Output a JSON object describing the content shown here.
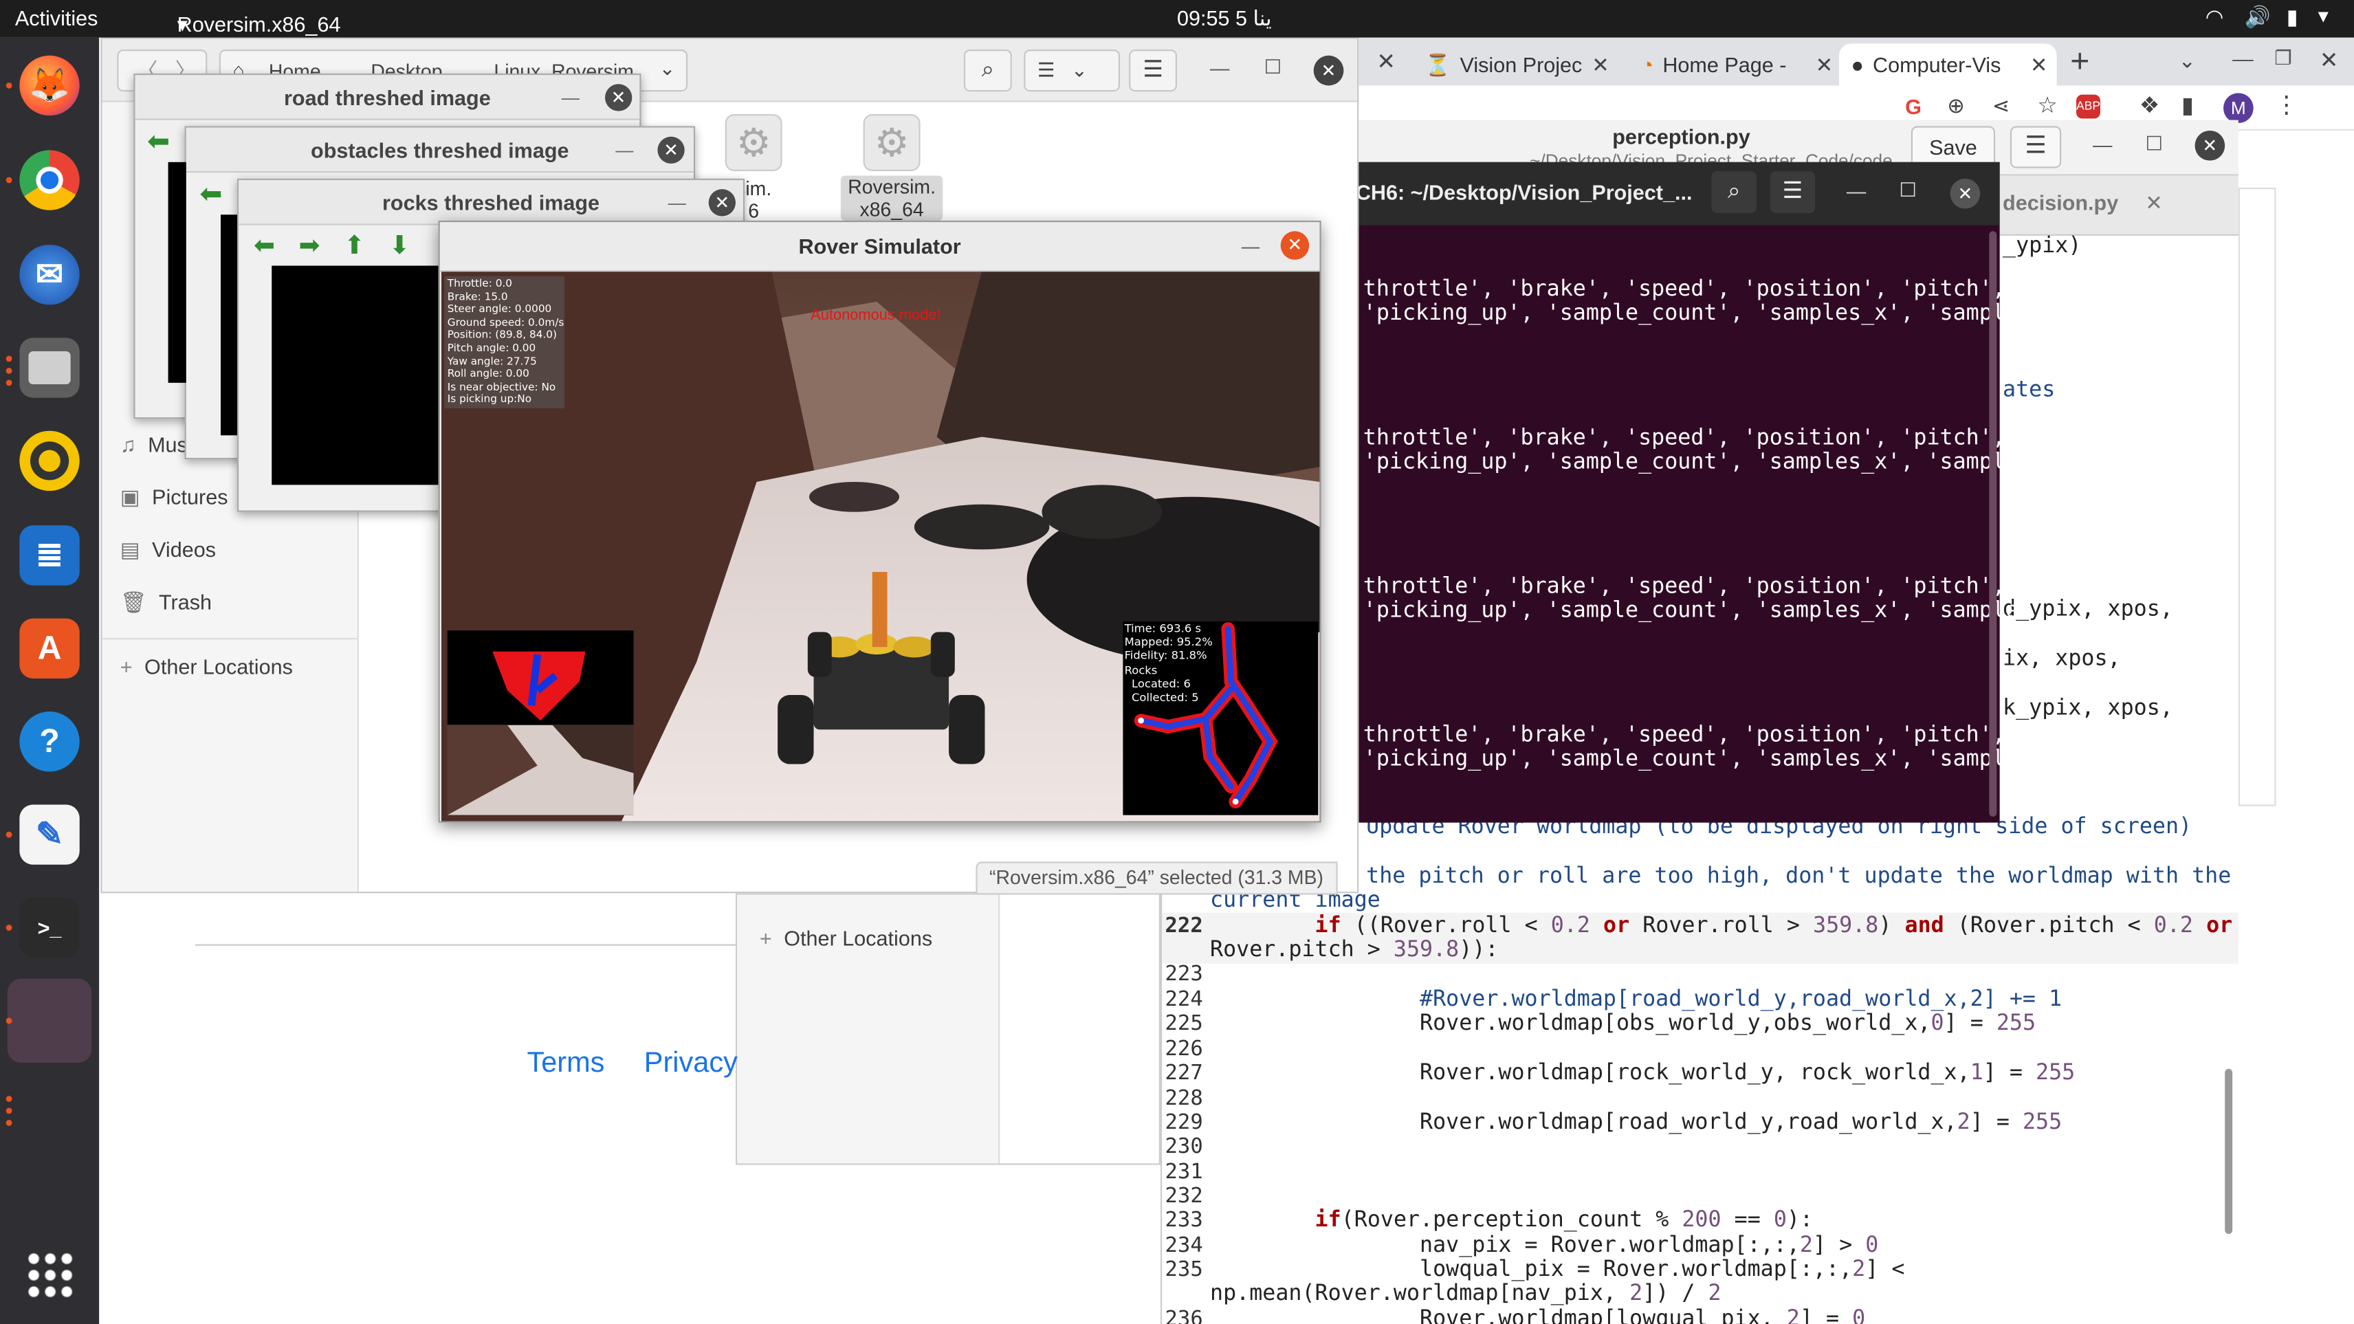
{
  "topbar": {
    "activities": "Activities",
    "app_menu": "Roversim.x86_64",
    "clock": "09:55 ﻳﻨﺎ 5"
  },
  "browser": {
    "tabs": [
      {
        "label": "Vision Projec",
        "icon": "vision-tab-icon"
      },
      {
        "label": "Home Page -",
        "icon": "home-tab-icon"
      },
      {
        "label": "Computer-Vis",
        "icon": "github-icon"
      }
    ],
    "footer_links": [
      "Terms",
      "Privacy"
    ],
    "avatar_letter": "M"
  },
  "gedit": {
    "title": "perception.py",
    "subtitle": "~/Desktop/Vision_Project_Starter_Code/code",
    "save_label": "Save",
    "tab_label": "decision.py",
    "right_fragments": [
      "_ypix)",
      "ates",
      "d_ypix, xpos,",
      "ix, xpos,",
      "k_ypix, xpos,"
    ],
    "comment_1": "Update Rover worldmap (to be displayed on right side of screen)",
    "comment_2": "the pitch or roll are too high, don't update the worldmap with the",
    "comment_3": "current image",
    "line_numbers": [
      "222",
      "223",
      "224",
      "225",
      "226",
      "227",
      "228",
      "229",
      "230",
      "231",
      "232",
      "233",
      "234",
      "235",
      "",
      "236"
    ]
  },
  "terminal": {
    "title": "CH6: ~/Desktop/Vision_Project_...",
    "line_a": "throttle', 'brake', 'speed', 'position', 'pitch',",
    "line_b": "'picking_up', 'sample_count', 'samples_x', 'sample"
  },
  "files": {
    "tabs": [
      "Home",
      "Desktop",
      "Linux_Roversim"
    ],
    "sidebar": [
      "Mus",
      "Pictures",
      "Videos",
      "Trash",
      "Other Locations"
    ],
    "icons": [
      {
        "label_1": "sim.",
        "label_2": "6"
      },
      {
        "label_1": "Roversim.",
        "label_2": "x86_64"
      }
    ],
    "status": "“Roversim.x86_64” selected  (31.3 MB)",
    "second_other_locations": "Other Locations"
  },
  "cv_windows": [
    {
      "title": "road threshed image"
    },
    {
      "title": "obstacles threshed image"
    },
    {
      "title": "rocks threshed image"
    }
  ],
  "rover_sim": {
    "title": "Rover Simulator",
    "mode": "Autonomous mode!",
    "telemetry": "Throttle: 0.0\nBrake: 15.0\nSteer angle: 0.0000\nGround speed: 0.0m/s\nPosition: (89.8, 84.0)\nPitch angle: 0.00\nYaw angle: 27.75\nRoll angle: 0.00\nIs near objective: No\nIs picking up:No",
    "stats": "Time: 693.6 s\nMapped: 95.2%\nFidelity: 81.8%\nRocks\n  Located: 6\n  Collected: 5"
  },
  "colors": {
    "terminal_bg": "#300a24",
    "ubuntu_orange": "#e95420",
    "dock_bg": "#2f2f33",
    "topbar_bg": "#1d1d1d",
    "keyword": "#a40000",
    "number": "#75507b"
  }
}
